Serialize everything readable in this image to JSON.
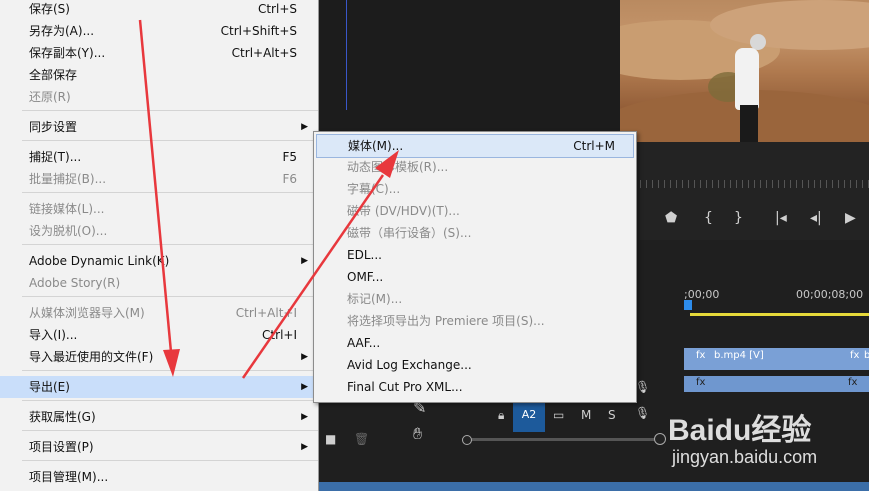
{
  "file_menu": {
    "items": [
      {
        "label": "保存(S)",
        "shortcut": "Ctrl+S",
        "disabled": false
      },
      {
        "label": "另存为(A)...",
        "shortcut": "Ctrl+Shift+S",
        "disabled": false
      },
      {
        "label": "保存副本(Y)...",
        "shortcut": "Ctrl+Alt+S",
        "disabled": false
      },
      {
        "label": "全部保存",
        "shortcut": "",
        "disabled": false
      },
      {
        "label": "还原(R)",
        "shortcut": "",
        "disabled": true
      },
      {
        "label": "同步设置",
        "shortcut": "",
        "disabled": false,
        "submenu": true
      },
      {
        "label": "捕捉(T)...",
        "shortcut": "F5",
        "disabled": false
      },
      {
        "label": "批量捕捉(B)...",
        "shortcut": "F6",
        "disabled": true
      },
      {
        "label": "链接媒体(L)...",
        "shortcut": "",
        "disabled": true
      },
      {
        "label": "设为脱机(O)...",
        "shortcut": "",
        "disabled": true
      },
      {
        "label": "Adobe Dynamic Link(K)",
        "shortcut": "",
        "disabled": false,
        "submenu": true
      },
      {
        "label": "Adobe Story(R)",
        "shortcut": "",
        "disabled": true
      },
      {
        "label": "从媒体浏览器导入(M)",
        "shortcut": "Ctrl+Alt+I",
        "disabled": true
      },
      {
        "label": "导入(I)...",
        "shortcut": "Ctrl+I",
        "disabled": false
      },
      {
        "label": "导入最近使用的文件(F)",
        "shortcut": "",
        "disabled": false,
        "submenu": true
      },
      {
        "label": "导出(E)",
        "shortcut": "",
        "disabled": false,
        "submenu": true,
        "highlighted": true
      },
      {
        "label": "获取属性(G)",
        "shortcut": "",
        "disabled": false,
        "submenu": true
      },
      {
        "label": "项目设置(P)",
        "shortcut": "",
        "disabled": false,
        "submenu": true
      },
      {
        "label": "项目管理(M)...",
        "shortcut": "",
        "disabled": false
      }
    ]
  },
  "export_submenu": {
    "items": [
      {
        "label": "媒体(M)...",
        "shortcut": "Ctrl+M",
        "disabled": false,
        "highlighted": true
      },
      {
        "label": "动态图形模板(R)...",
        "shortcut": "",
        "disabled": true
      },
      {
        "label": "字幕(C)...",
        "shortcut": "",
        "disabled": true
      },
      {
        "label": "磁带 (DV/HDV)(T)...",
        "shortcut": "",
        "disabled": true
      },
      {
        "label": "磁带（串行设备）(S)...",
        "shortcut": "",
        "disabled": true
      },
      {
        "label": "EDL...",
        "shortcut": "",
        "disabled": false
      },
      {
        "label": "OMF...",
        "shortcut": "",
        "disabled": false
      },
      {
        "label": "标记(M)...",
        "shortcut": "",
        "disabled": true
      },
      {
        "label": "将选择项导出为 Premiere 项目(S)...",
        "shortcut": "",
        "disabled": true
      },
      {
        "label": "AAF...",
        "shortcut": "",
        "disabled": false
      },
      {
        "label": "Avid Log Exchange...",
        "shortcut": "",
        "disabled": false
      },
      {
        "label": "Final Cut Pro XML...",
        "shortcut": "",
        "disabled": false
      }
    ]
  },
  "timeline": {
    "timecode_start": ";00;00",
    "timecode_end": "00;00;08;00",
    "clip_label": "b.mp4 [V]",
    "clip_label_2": "b",
    "track_target": "A2",
    "track_m": "M",
    "track_s": "S"
  },
  "watermark": {
    "brand": "Baidu经验",
    "url": "jingyan.baidu.com"
  },
  "colors": {
    "menu_bg": "#f2f2f2",
    "highlight": "#c9defa",
    "annotation_arrow": "#e8383d",
    "clip": "#7aa0d6",
    "timeline_bar": "#e6d93a"
  }
}
